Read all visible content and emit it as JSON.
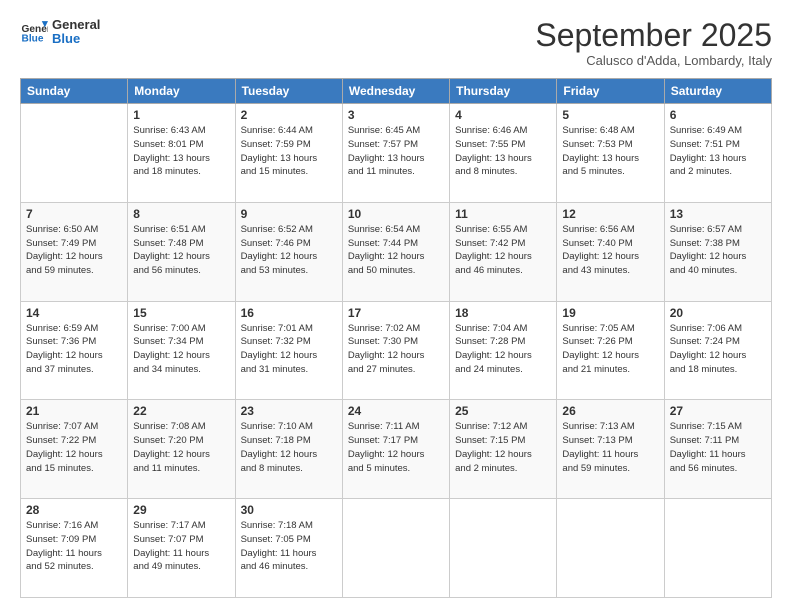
{
  "header": {
    "logo_line1": "General",
    "logo_line2": "Blue",
    "title": "September 2025",
    "subtitle": "Calusco d'Adda, Lombardy, Italy"
  },
  "days_of_week": [
    "Sunday",
    "Monday",
    "Tuesday",
    "Wednesday",
    "Thursday",
    "Friday",
    "Saturday"
  ],
  "weeks": [
    [
      {
        "day": "",
        "info": ""
      },
      {
        "day": "1",
        "info": "Sunrise: 6:43 AM\nSunset: 8:01 PM\nDaylight: 13 hours\nand 18 minutes."
      },
      {
        "day": "2",
        "info": "Sunrise: 6:44 AM\nSunset: 7:59 PM\nDaylight: 13 hours\nand 15 minutes."
      },
      {
        "day": "3",
        "info": "Sunrise: 6:45 AM\nSunset: 7:57 PM\nDaylight: 13 hours\nand 11 minutes."
      },
      {
        "day": "4",
        "info": "Sunrise: 6:46 AM\nSunset: 7:55 PM\nDaylight: 13 hours\nand 8 minutes."
      },
      {
        "day": "5",
        "info": "Sunrise: 6:48 AM\nSunset: 7:53 PM\nDaylight: 13 hours\nand 5 minutes."
      },
      {
        "day": "6",
        "info": "Sunrise: 6:49 AM\nSunset: 7:51 PM\nDaylight: 13 hours\nand 2 minutes."
      }
    ],
    [
      {
        "day": "7",
        "info": "Sunrise: 6:50 AM\nSunset: 7:49 PM\nDaylight: 12 hours\nand 59 minutes."
      },
      {
        "day": "8",
        "info": "Sunrise: 6:51 AM\nSunset: 7:48 PM\nDaylight: 12 hours\nand 56 minutes."
      },
      {
        "day": "9",
        "info": "Sunrise: 6:52 AM\nSunset: 7:46 PM\nDaylight: 12 hours\nand 53 minutes."
      },
      {
        "day": "10",
        "info": "Sunrise: 6:54 AM\nSunset: 7:44 PM\nDaylight: 12 hours\nand 50 minutes."
      },
      {
        "day": "11",
        "info": "Sunrise: 6:55 AM\nSunset: 7:42 PM\nDaylight: 12 hours\nand 46 minutes."
      },
      {
        "day": "12",
        "info": "Sunrise: 6:56 AM\nSunset: 7:40 PM\nDaylight: 12 hours\nand 43 minutes."
      },
      {
        "day": "13",
        "info": "Sunrise: 6:57 AM\nSunset: 7:38 PM\nDaylight: 12 hours\nand 40 minutes."
      }
    ],
    [
      {
        "day": "14",
        "info": "Sunrise: 6:59 AM\nSunset: 7:36 PM\nDaylight: 12 hours\nand 37 minutes."
      },
      {
        "day": "15",
        "info": "Sunrise: 7:00 AM\nSunset: 7:34 PM\nDaylight: 12 hours\nand 34 minutes."
      },
      {
        "day": "16",
        "info": "Sunrise: 7:01 AM\nSunset: 7:32 PM\nDaylight: 12 hours\nand 31 minutes."
      },
      {
        "day": "17",
        "info": "Sunrise: 7:02 AM\nSunset: 7:30 PM\nDaylight: 12 hours\nand 27 minutes."
      },
      {
        "day": "18",
        "info": "Sunrise: 7:04 AM\nSunset: 7:28 PM\nDaylight: 12 hours\nand 24 minutes."
      },
      {
        "day": "19",
        "info": "Sunrise: 7:05 AM\nSunset: 7:26 PM\nDaylight: 12 hours\nand 21 minutes."
      },
      {
        "day": "20",
        "info": "Sunrise: 7:06 AM\nSunset: 7:24 PM\nDaylight: 12 hours\nand 18 minutes."
      }
    ],
    [
      {
        "day": "21",
        "info": "Sunrise: 7:07 AM\nSunset: 7:22 PM\nDaylight: 12 hours\nand 15 minutes."
      },
      {
        "day": "22",
        "info": "Sunrise: 7:08 AM\nSunset: 7:20 PM\nDaylight: 12 hours\nand 11 minutes."
      },
      {
        "day": "23",
        "info": "Sunrise: 7:10 AM\nSunset: 7:18 PM\nDaylight: 12 hours\nand 8 minutes."
      },
      {
        "day": "24",
        "info": "Sunrise: 7:11 AM\nSunset: 7:17 PM\nDaylight: 12 hours\nand 5 minutes."
      },
      {
        "day": "25",
        "info": "Sunrise: 7:12 AM\nSunset: 7:15 PM\nDaylight: 12 hours\nand 2 minutes."
      },
      {
        "day": "26",
        "info": "Sunrise: 7:13 AM\nSunset: 7:13 PM\nDaylight: 11 hours\nand 59 minutes."
      },
      {
        "day": "27",
        "info": "Sunrise: 7:15 AM\nSunset: 7:11 PM\nDaylight: 11 hours\nand 56 minutes."
      }
    ],
    [
      {
        "day": "28",
        "info": "Sunrise: 7:16 AM\nSunset: 7:09 PM\nDaylight: 11 hours\nand 52 minutes."
      },
      {
        "day": "29",
        "info": "Sunrise: 7:17 AM\nSunset: 7:07 PM\nDaylight: 11 hours\nand 49 minutes."
      },
      {
        "day": "30",
        "info": "Sunrise: 7:18 AM\nSunset: 7:05 PM\nDaylight: 11 hours\nand 46 minutes."
      },
      {
        "day": "",
        "info": ""
      },
      {
        "day": "",
        "info": ""
      },
      {
        "day": "",
        "info": ""
      },
      {
        "day": "",
        "info": ""
      }
    ]
  ]
}
